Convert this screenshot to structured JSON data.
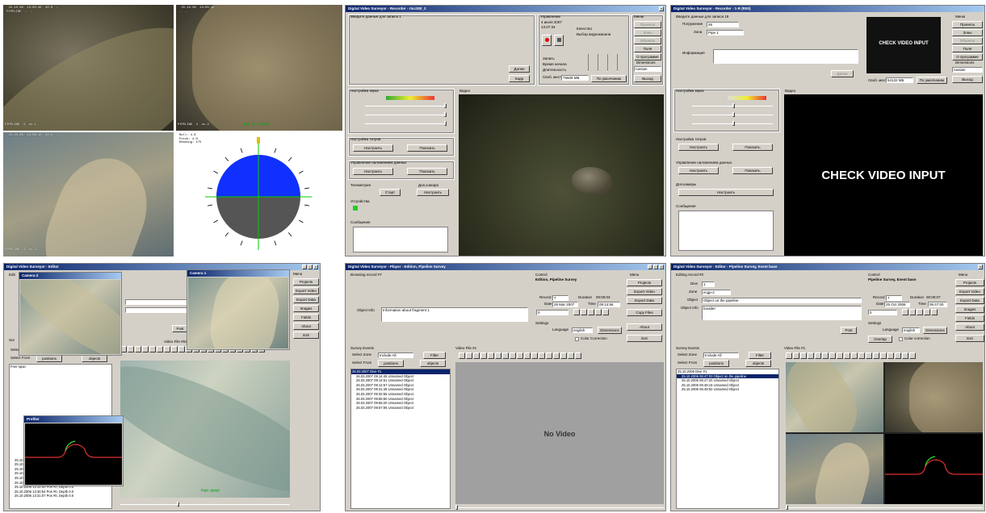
{
  "panel1": {
    "overlay_tl": "  25.10.06  13:05:46  40.6  …  \n PIPELINE  …  …",
    "overlay_tr": "  25.10.06  13:05:46  …  \n …  …",
    "overlay_bl": "  25.10.06  13:06:10  40.8  …  \n …  …",
    "label_tl": "PIPELINE  4  ov-1",
    "label_tr": "PIPELINE  4  ov-2",
    "label_bl": "PIPELINE  4  ov-3",
    "status_tr": "Buy the result",
    "compass_info": "Roll: 4.8\nPitch: 4.0\nHeading: 175"
  },
  "panel2": {
    "title": "Digital Video Surveyor - Recorder - rtsc300_2",
    "record_group": "Введите данные для записи 1",
    "control_group": "Управление",
    "date": "4 июля 2007",
    "time": "13:27:34",
    "quality_label": "Качество",
    "select_video_label": "Выбор видеоканала",
    "record_btn": "Rec",
    "stop_btn": "Stop",
    "write_label": "Запись",
    "start_time_label": "Время начала",
    "duration_label": "Длительность",
    "free_space_label": "Своб. место",
    "free_space_value": "75608 МБ",
    "by_default_btn": "По умолчанию",
    "next_btn": "Далее",
    "frame_btn": "Кадр",
    "sound_group": "Настройка звука",
    "video_label": "Видео",
    "tint_group": "Настройка титров",
    "configure_btn": "Настроить",
    "show_btn": "Показать",
    "overlay_group": "Управление наложением данных",
    "telemetry_label": "Телеметрия",
    "start_btn": "Старт",
    "extra_label": "Доп.а.вкара",
    "devices_label": "Устройства",
    "messages_label": "Сообщения",
    "menu_label": "Меню",
    "menu_items": [
      "Проекты",
      "Зоны",
      "Объекты",
      "Поля",
      "О программе"
    ],
    "dimensions_label": "Dimensions",
    "lang_value": "russian",
    "exit_btn": "Выход"
  },
  "panel3": {
    "title": "Digital Video Surveyor - Recorder - 1-R (R00)",
    "record_group": "Введите данные для записи 19",
    "stage_label": "Погружение",
    "stage_value": "46",
    "zone_label": "Зона",
    "zone_value": "Pipe 1",
    "info_label": "Информация",
    "check_small": "CHECK VIDEO INPUT",
    "check_big": "CHECK VIDEO INPUT",
    "free_space_label": "Своб. место",
    "free_space_value": "54132 МБ",
    "by_default_btn": "По умолчанию",
    "next_btn": "Далее",
    "sound_group": "Настройка звука",
    "video_label": "Видео",
    "tint_group": "Настройка титров",
    "configure_btn": "Настроить",
    "show_btn": "Показать",
    "overlay_group": "Управление наложением данных",
    "extra_label": "Доп.камеры",
    "messages_label": "Сообщения",
    "menu_label": "Меню",
    "menu_items": [
      "Проекты",
      "Зоны",
      "Объекты",
      "Поля",
      "О программе"
    ],
    "dimensions_label": "Dimensions",
    "lang_value": "russian",
    "exit_btn": "Выход"
  },
  "panel4": {
    "title": "Digital Video Surveyor - Editor",
    "camera2_title": "Camera 2",
    "camera1_title": "Camera 1",
    "edit_label": "Edit",
    "survey_label": "Sur",
    "select_zone_label": "Select Zone",
    "select_zone_value": "Include All",
    "select_from_label": "Select From",
    "positions_btn": "positions",
    "objects_btn": "objects",
    "filter_btn": "Filter",
    "post_btn": "Post",
    "video_file_label": "Video File #637",
    "profiler_title": "Profiler",
    "tree_root": "Free span",
    "tree_items": [
      "25.10.2006 07:13:00 Pos #0, Depth 0.0",
      "25.10.2006 07:14:55 Pos #0, Depth 0.0",
      "25.10.2006 07:23:03 Pos #0, Depth 0.0",
      "25.10.2006 13:14:45 Pos #0, Depth 0.0",
      "25.10.2006 13:14:45 Pos #0, Depth 0.0",
      "25.10.2006 13:23:58 Pos #0, Depth 0.0",
      "25.10.2006 13:24:00 Pos #0, Depth 0.0",
      "25.10.2006 13:30:54 Pos #0, Depth 0.0",
      "25.10.2006 13:31:07 Pos #0, Depth 0.0"
    ],
    "menu_label": "Menu",
    "menu_items": [
      "Projects",
      "Export Video",
      "Export Data",
      "Images",
      "Fields",
      "About",
      "Exit"
    ],
    "cam_status": "Pipe apsys"
  },
  "panel5": {
    "title": "Digital Video Surveyor - Player - Edition, Pipeline Survey",
    "browsing_label": "Browsing record #7",
    "object_info_label": "Object Info",
    "object_info_value": "Information about fragment 1",
    "control_label": "Control",
    "project_name": "Edition, Pipeline Survey",
    "record_label": "Record",
    "record_value": "7",
    "duration_label": "Duration",
    "duration_value": "00:00:03",
    "date_label": "Date",
    "date_value": "26 Mar 2007",
    "time_label": "Time",
    "time_value": "09:14:56",
    "counter_value": "0",
    "settings_label": "Settings",
    "language_label": "Language",
    "language_value": "english",
    "dimensions_btn": "Dimensions",
    "color_correction_label": "Color Correction",
    "survey_events_label": "Survey Events",
    "select_zone_label": "Select Zone",
    "select_zone_value": "Include All",
    "select_from_label": "Select From",
    "positions_btn": "positions",
    "objects_btn": "objects",
    "filter_btn": "Filter",
    "video_file_label": "Video File #1",
    "no_video": "No Video",
    "copy_files_btn": "Copy Files",
    "tree_root": "26.03.2007 Dive #1",
    "tree_items": [
      "26.03.2007 09:14:45 Unnamed Object",
      "26.03.2007 09:14:51 Unnamed Object",
      "26.03.2007 09:14:57 Unnamed Object",
      "26.03.2007 09:31:49 Unnamed Object",
      "26.03.2007 09:32:55 Unnamed Object",
      "26.03.2007 09:55:50 Unnamed Object",
      "26.03.2007 09:56:20 Unnamed Object",
      "26.03.2007 09:57:06 Unnamed Object"
    ],
    "menu_label": "Menu",
    "menu_items": [
      "Projects",
      "Export Video",
      "Export Data",
      "About",
      "Exit"
    ]
  },
  "panel6": {
    "title": "Digital Video Surveyor - Editor - Pipeline Survey, Event base",
    "editing_label": "Editing record #0",
    "dive_label": "Dive",
    "dive_value": "1",
    "zone_label": "Zone",
    "zone_value": "ecgp-2",
    "object_label": "Object",
    "object_value": "Object on the pipeline",
    "object_info_label": "Object Info",
    "object_info_value": "boulder",
    "post_btn": "Post",
    "control_label": "Control",
    "project_name": "Pipeline Survey, Event base",
    "record_label": "Record",
    "record_value": "7",
    "duration_label": "Duration",
    "duration_value": "00:00:07",
    "date_label": "Date",
    "date_value": "25 Oct 2006",
    "time_label": "Time",
    "time_value": "06:47:00",
    "counter_value": "0",
    "settings_label": "Settings",
    "language_label": "Language",
    "language_value": "english",
    "dimensions_btn": "Dimensions",
    "overlap_btn": "Overlap",
    "color_correction_label": "Color correction",
    "survey_events_label": "Survey Events",
    "select_zone_label": "Select Zone",
    "select_zone_value": "Include All",
    "select_from_label": "Select From",
    "positions_btn": "positions",
    "objects_btn": "objects",
    "filter_btn": "Filter",
    "video_file_label": "Video File #1",
    "tree_root": "25.10.2006 Dive #1",
    "tree_items": [
      "25.10.2006 06:47:03 Object on the pipeline",
      "25.10.2006 06:47:20 Unnamed Object",
      "25.10.2006 06:48:16 Unnamed Object",
      "25.10.2006 06:49:52 Unnamed Object"
    ],
    "menu_label": "Menu",
    "menu_items": [
      "Projects",
      "Export Video",
      "Export Data",
      "Images",
      "Fields",
      "About",
      "Exit"
    ]
  }
}
